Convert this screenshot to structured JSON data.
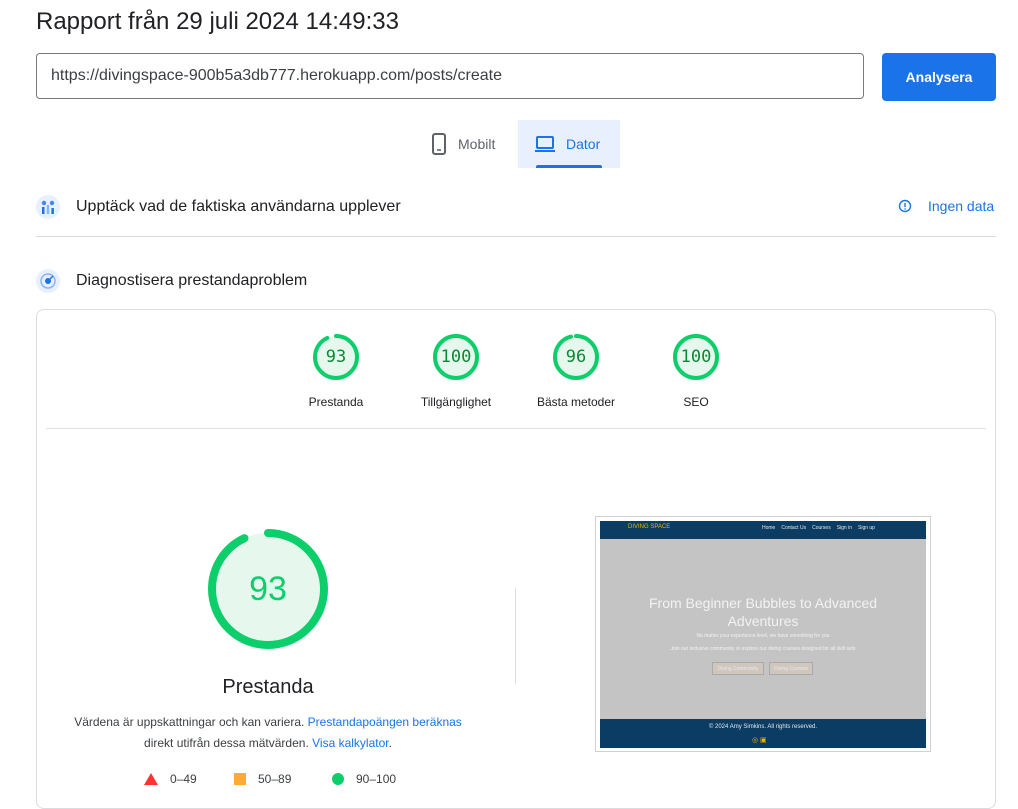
{
  "header": {
    "title": "Rapport från 29 juli 2024 14:49:33"
  },
  "url_input": {
    "value": "https://divingspace-900b5a3db777.herokuapp.com/posts/create"
  },
  "analyze_button": {
    "label": "Analysera"
  },
  "tabs": [
    {
      "label": "Mobilt",
      "icon": "smartphone-icon",
      "selected": false
    },
    {
      "label": "Dator",
      "icon": "laptop-icon",
      "selected": true
    }
  ],
  "field_data": {
    "title": "Upptäck vad de faktiska användarna upplever",
    "status": "Ingen data"
  },
  "lab_data": {
    "title": "Diagnostisera prestandaproblem"
  },
  "scores": [
    {
      "label": "Prestanda",
      "value": 93
    },
    {
      "label": "Tillgänglighet",
      "value": 100
    },
    {
      "label": "Bästa metoder",
      "value": 96
    },
    {
      "label": "SEO",
      "value": 100
    }
  ],
  "performance": {
    "score": 93,
    "label": "Prestanda",
    "desc_part1": "Värdena är uppskattningar och kan variera. ",
    "link_calc": "Prestandapoängen beräknas",
    "desc_part2": "direkt utifrån dessa mätvärden. ",
    "link_calculator": "Visa kalkylator",
    "desc_end": "."
  },
  "legend": [
    {
      "range": "0–49",
      "color": "#ff3333",
      "shape": "triangle"
    },
    {
      "range": "50–89",
      "color": "#ffaa33",
      "shape": "square"
    },
    {
      "range": "90–100",
      "color": "#0cce6b",
      "shape": "circle"
    }
  ],
  "screenshot": {
    "brand": "DIVING SPACE",
    "nav_links": [
      "Home",
      "Contact Us",
      "Courses",
      "Sign in",
      "Sign up"
    ],
    "headline": "From Beginner Bubbles to Advanced Adventures",
    "subtext1": "No matter your experience level, we have something for you",
    "subtext2": "Join our inclusive community or explore our diving courses designed for all skill sets",
    "buttons": [
      "Diving Community",
      "Diving Courses"
    ],
    "footer": "© 2024 Amy Simkins. All rights reserved."
  },
  "colors": {
    "accent": "#1a73e8",
    "pass": "#0cce6b",
    "pass_bg": "#e6f8ee"
  }
}
